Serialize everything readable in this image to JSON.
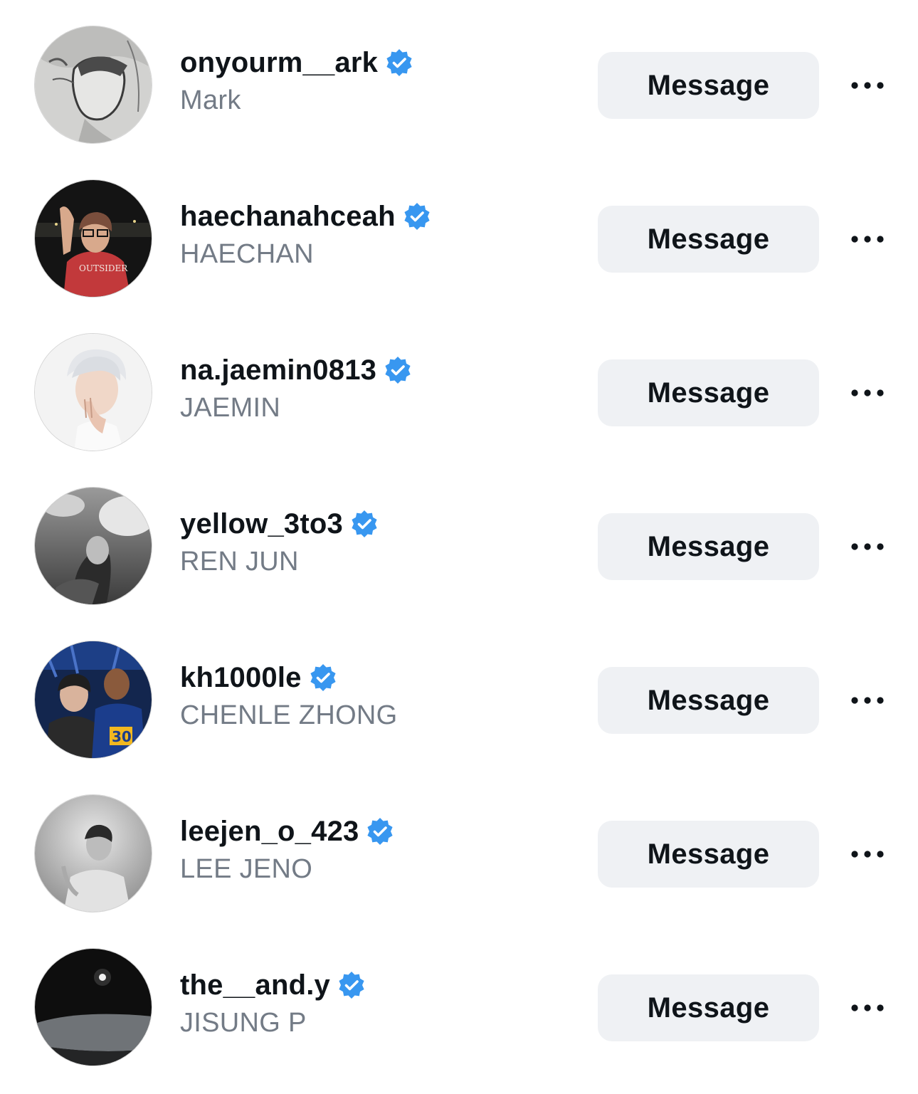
{
  "colors": {
    "verified_badge": "#3897f0",
    "button_bg": "#eff1f4",
    "username": "#0f1419",
    "fullname": "#737b86"
  },
  "rows": [
    {
      "username": "onyourm__ark",
      "fullname": "Mark",
      "verified": true,
      "button_label": "Message",
      "avatar": "sketch-portrait",
      "more_icon": "more-horizontal-icon"
    },
    {
      "username": "haechanahceah",
      "fullname": "HAECHAN",
      "verified": true,
      "button_label": "Message",
      "avatar": "night-photo-red-shirt",
      "more_icon": "more-horizontal-icon"
    },
    {
      "username": "na.jaemin0813",
      "fullname": "JAEMIN",
      "verified": true,
      "button_label": "Message",
      "avatar": "white-hair-portrait",
      "more_icon": "more-horizontal-icon"
    },
    {
      "username": "yellow_3to3",
      "fullname": "REN JUN",
      "verified": true,
      "button_label": "Message",
      "avatar": "bw-sky-portrait",
      "more_icon": "more-horizontal-icon"
    },
    {
      "username": "kh1000le",
      "fullname": "CHENLE ZHONG",
      "verified": true,
      "button_label": "Message",
      "avatar": "arena-photo-two-people",
      "more_icon": "more-horizontal-icon"
    },
    {
      "username": "leejen_o_423",
      "fullname": "LEE JENO",
      "verified": true,
      "button_label": "Message",
      "avatar": "bw-portrait",
      "more_icon": "more-horizontal-icon"
    },
    {
      "username": "the__and.y",
      "fullname": "JISUNG P",
      "verified": true,
      "button_label": "Message",
      "avatar": "dark-night-sky",
      "more_icon": "more-horizontal-icon"
    }
  ]
}
